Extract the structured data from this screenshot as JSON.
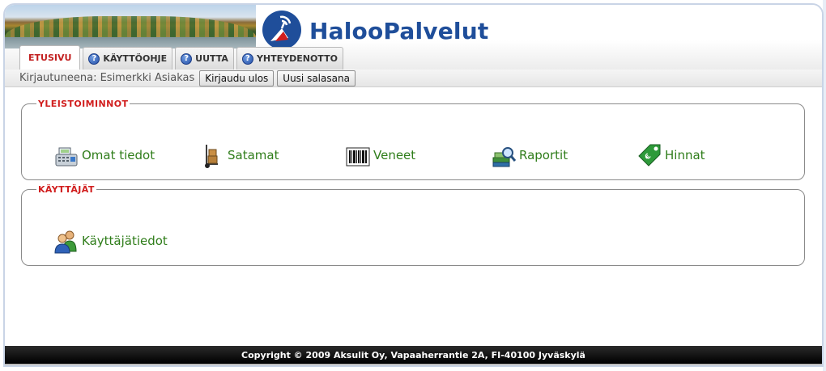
{
  "header": {
    "logo_text": "HalooPalvelut"
  },
  "tabs": [
    {
      "label": "ETUSIVU",
      "icon": "",
      "active": true
    },
    {
      "label": "KÄYTTÖOHJE",
      "icon": "help-icon",
      "active": false
    },
    {
      "label": "UUTTA",
      "icon": "help-icon",
      "active": false
    },
    {
      "label": "YHTEYDENOTTO",
      "icon": "help-icon",
      "active": false
    }
  ],
  "userbar": {
    "logged_in_text": "Kirjautuneena: Esimerkki Asiakas",
    "logout_label": "Kirjaudu ulos",
    "new_password_label": "Uusi salasana"
  },
  "general": {
    "legend": "YLEISTOIMINNOT",
    "items": [
      {
        "label": "Omat tiedot",
        "icon": "cash-register-icon"
      },
      {
        "label": "Satamat",
        "icon": "hand-truck-icon"
      },
      {
        "label": "Veneet",
        "icon": "barcode-icon"
      },
      {
        "label": "Raportit",
        "icon": "report-magnifier-icon"
      },
      {
        "label": "Hinnat",
        "icon": "price-tag-icon"
      }
    ]
  },
  "users": {
    "legend": "KÄYTTÄJÄT",
    "items": [
      {
        "label": "Käyttäjätiedot",
        "icon": "users-icon"
      }
    ]
  },
  "footer": {
    "copyright": "Copyright © 2009 Aksulit Oy, Vapaaherrantie 2A, FI-40100 Jyväskylä"
  },
  "colors": {
    "brand_blue": "#1f4e9a",
    "active_tab_red": "#c21f1f",
    "legend_red": "#d11e1e",
    "link_green": "#2f7d1a"
  }
}
